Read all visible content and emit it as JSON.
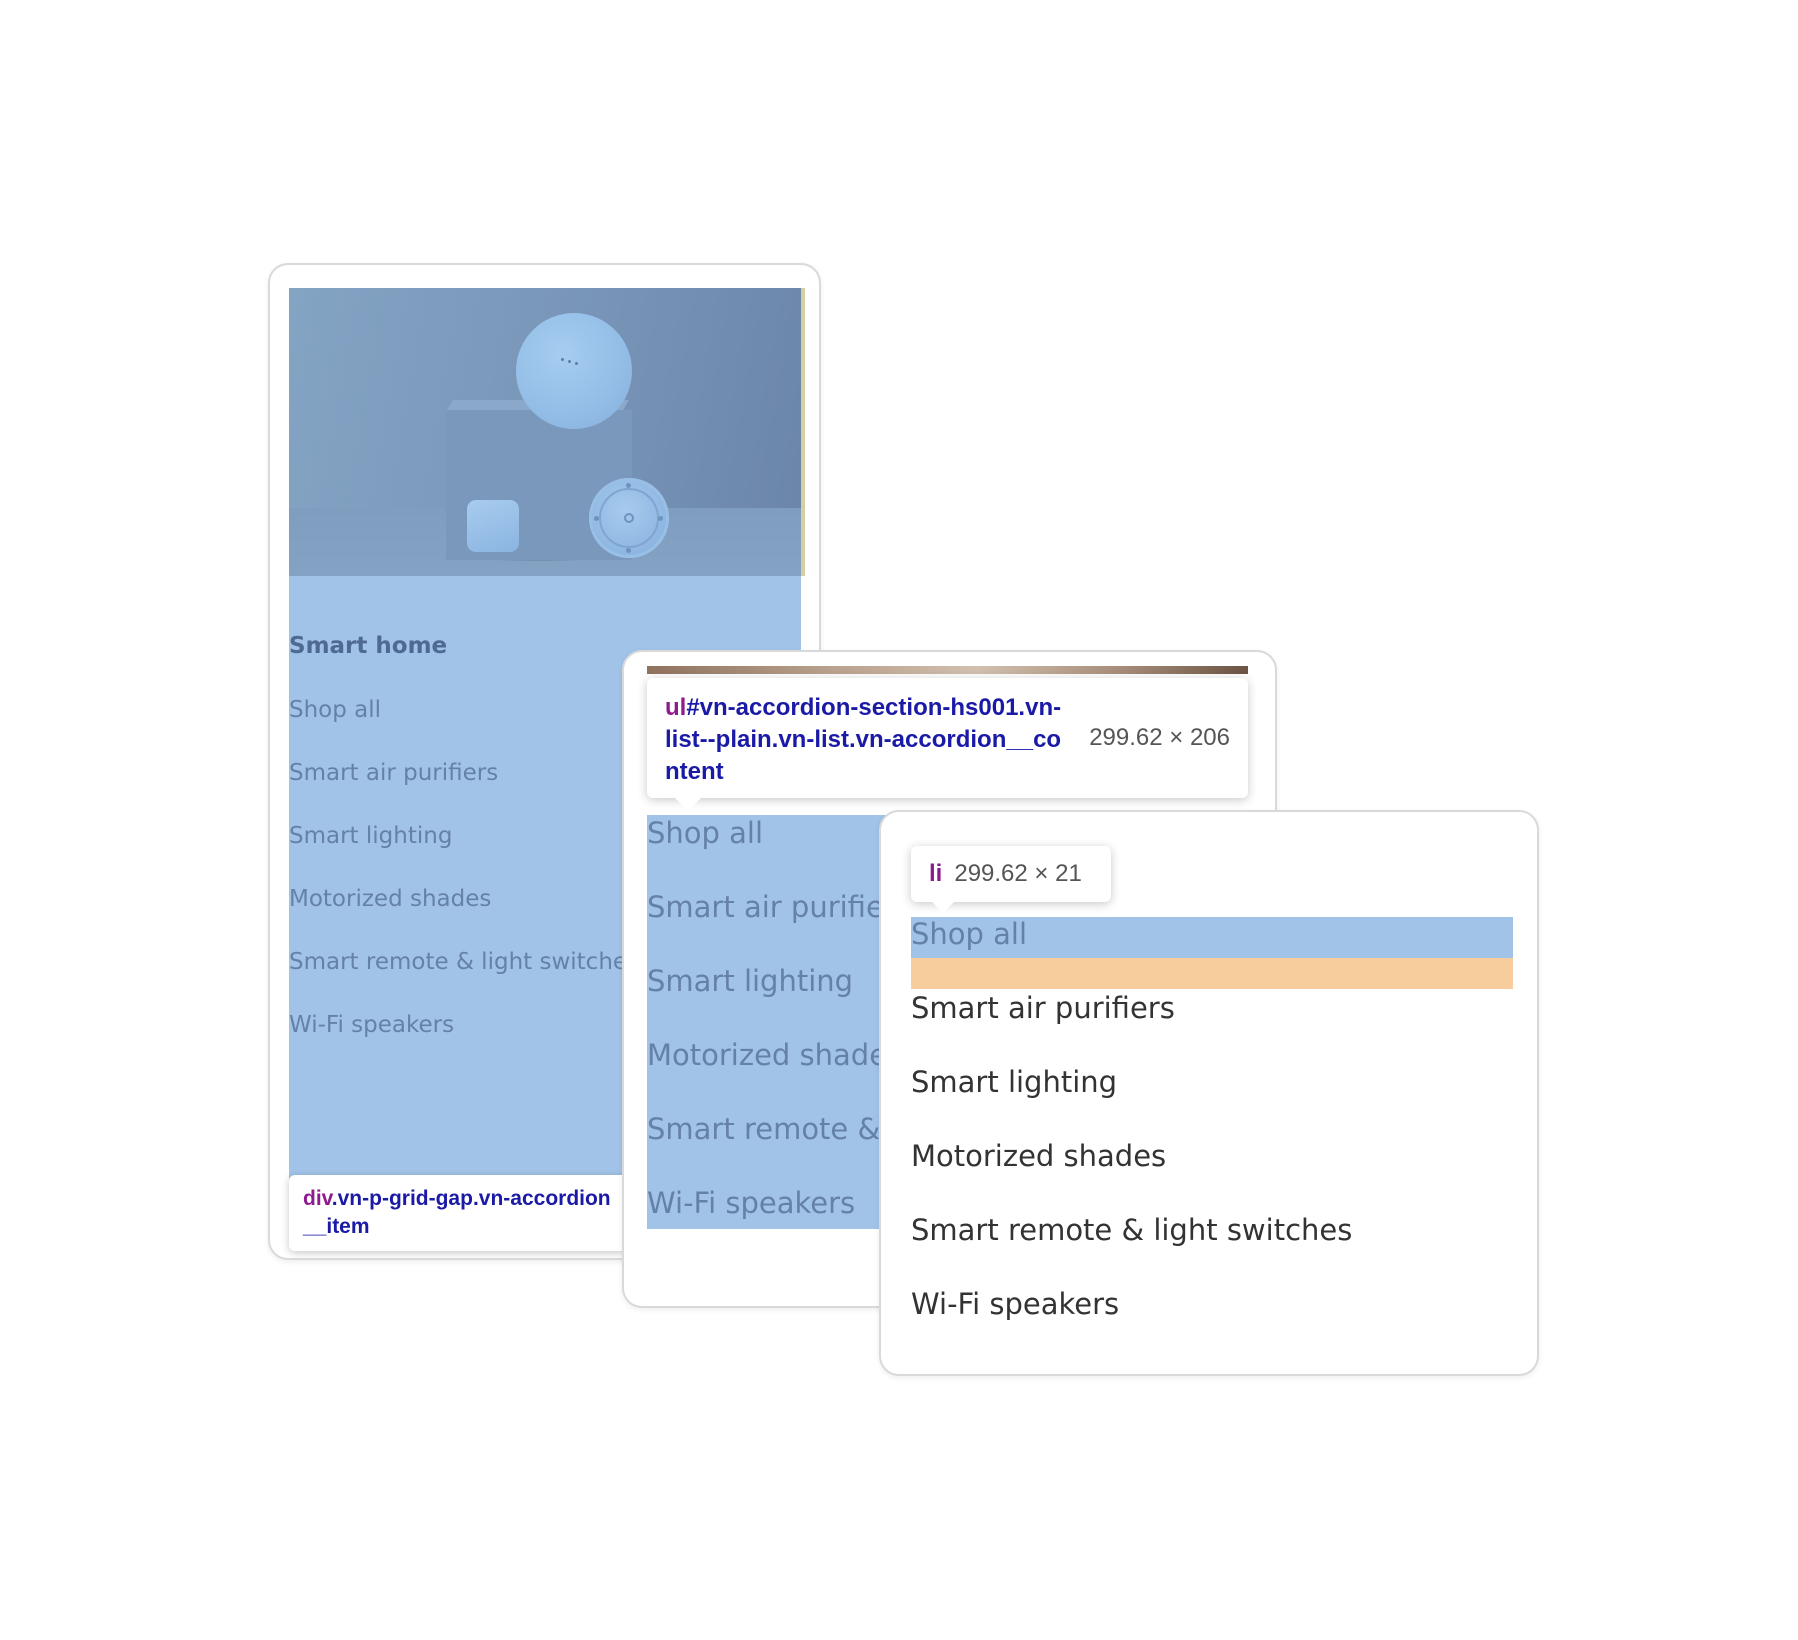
{
  "card_nav": {
    "title": "Smart home",
    "items": [
      {
        "label": "Shop all"
      },
      {
        "label": "Smart air purifiers"
      },
      {
        "label": "Smart lighting"
      },
      {
        "label": "Motorized shades"
      },
      {
        "label": "Smart remote & light switches"
      },
      {
        "label": "Wi-Fi speakers"
      }
    ],
    "inspector_tooltip": {
      "element": "div",
      "classes": ".vn-p-grid-gap.vn-accordion__item"
    }
  },
  "card_list": {
    "items": [
      {
        "label": "Shop all"
      },
      {
        "label": "Smart air purifiers"
      },
      {
        "label": "Smart lighting"
      },
      {
        "label": "Motorized shades"
      },
      {
        "label": "Smart remote & light switches"
      },
      {
        "label": "Wi-Fi speakers"
      }
    ],
    "inspector_tooltip": {
      "element": "ul",
      "selector": "#vn-accordion-section-hs001.vn-list--plain.vn-list.vn-accordion__content",
      "dimensions": "299.62 × 206"
    }
  },
  "card_item": {
    "items": [
      {
        "label": "Shop all"
      },
      {
        "label": "Smart air purifiers"
      },
      {
        "label": "Smart lighting"
      },
      {
        "label": "Motorized shades"
      },
      {
        "label": "Smart remote & light switches"
      },
      {
        "label": "Wi-Fi speakers"
      }
    ],
    "inspector_tooltip": {
      "element": "li",
      "dimensions": "299.62 × 21"
    }
  },
  "colors": {
    "highlight_content": "#a1c3e7",
    "highlight_margin": "#f7cd9d",
    "tag_element": "#8e1b8e",
    "tag_selector": "#1a1aa6"
  }
}
